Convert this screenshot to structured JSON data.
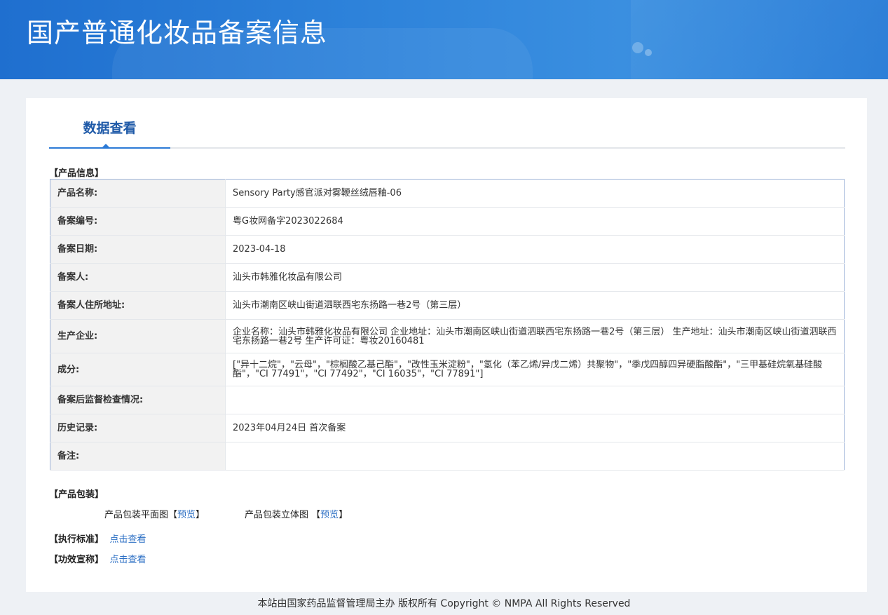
{
  "header": {
    "title": "国产普通化妆品备案信息"
  },
  "tabs": [
    {
      "label": "数据查看"
    }
  ],
  "product_info": {
    "section_label": "【产品信息】",
    "rows": [
      {
        "key": "产品名称:",
        "value": "Sensory Party感官派对雾鞭丝绒唇釉-06"
      },
      {
        "key": "备案编号:",
        "value": "粤G妆网备字2023022684"
      },
      {
        "key": "备案日期:",
        "value": "2023-04-18"
      },
      {
        "key": "备案人:",
        "value": "汕头市韩雅化妆品有限公司"
      },
      {
        "key": "备案人住所地址:",
        "value": "汕头市潮南区峡山街道泗联西宅东扬路一巷2号（第三层）"
      },
      {
        "key": "生产企业:",
        "value": "企业名称：汕头市韩雅化妆品有限公司 企业地址：汕头市潮南区峡山街道泗联西宅东扬路一巷2号（第三层） 生产地址：汕头市潮南区峡山街道泗联西宅东扬路一巷2号 生产许可证：粤妆20160481"
      },
      {
        "key": "成分:",
        "value": "[\"异十二烷\"，\"云母\"，\"棕榈酸乙基己酯\"，\"改性玉米淀粉\"，\"氢化（苯乙烯/异戊二烯）共聚物\"，\"季戊四醇四异硬脂酸酯\"，\"三甲基硅烷氧基硅酸酯\"，\"CI 77491\"，\"CI 77492\"，\"CI 16035\"，\"CI 77891\"]"
      },
      {
        "key": "备案后监督检查情况:",
        "value": ""
      },
      {
        "key": "历史记录:",
        "value": "2023年04月24日 首次备案"
      },
      {
        "key": "备注:",
        "value": ""
      }
    ]
  },
  "packaging": {
    "section_label": "【产品包装】",
    "flat_label": "产品包装平面图",
    "flat_link": "预览",
    "solid_label": "产品包装立体图",
    "solid_link": "预览",
    "bracket_open": "【",
    "bracket_close": "】"
  },
  "standard": {
    "section_label": "【执行标准】",
    "link": "点击查看"
  },
  "efficacy": {
    "section_label": "【功效宣称】",
    "link": "点击查看"
  },
  "footer": {
    "text": "本站由国家药品监督管理局主办 版权所有 Copyright © NMPA All Rights Reserved"
  }
}
